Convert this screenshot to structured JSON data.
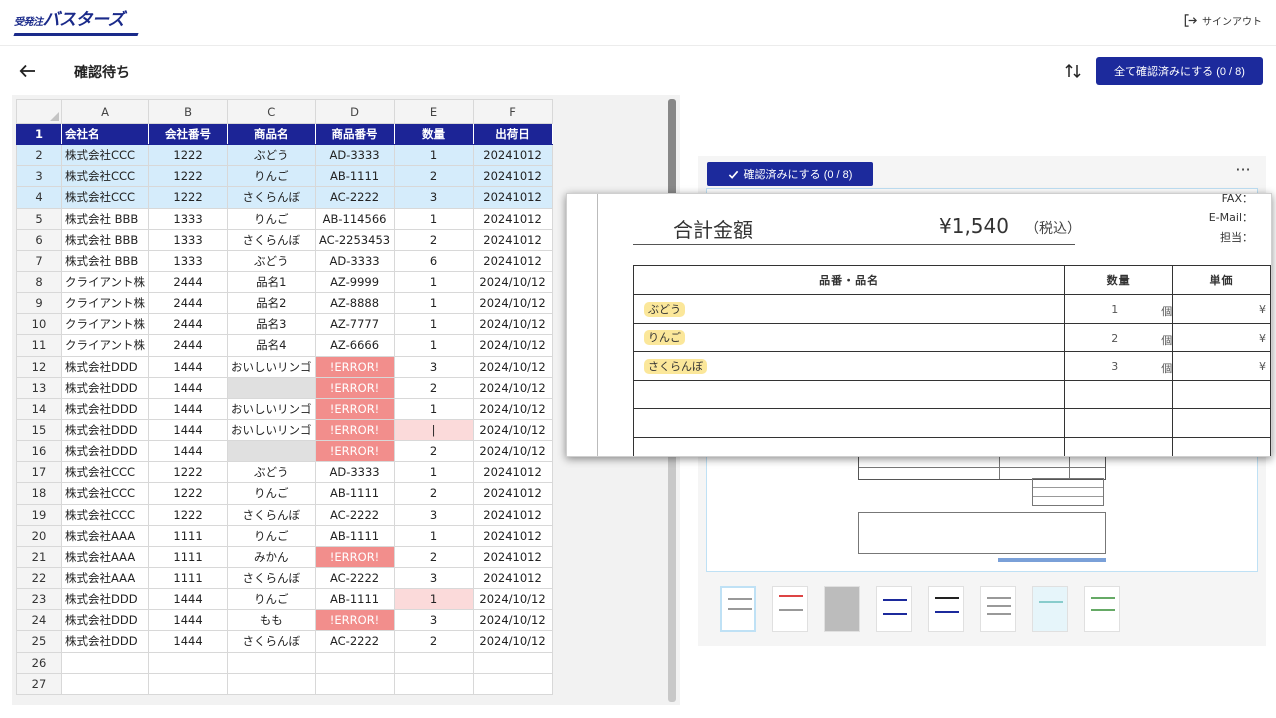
{
  "app": {
    "logo": {
      "prefix": "受発注",
      "main": "バスターズ"
    },
    "signout_label": "サインアウト"
  },
  "page": {
    "title": "確認待ち",
    "confirm_all_label": "全て確認済みにする (0 / 8)"
  },
  "sheet": {
    "columns": [
      "A",
      "B",
      "C",
      "D",
      "E",
      "F"
    ],
    "rows": [
      {
        "n": "1",
        "cells": [
          "会社名",
          "会社番号",
          "商品名",
          "商品番号",
          "数量",
          "出荷日"
        ],
        "style": "header"
      },
      {
        "n": "2",
        "cells": [
          "株式会社CCC",
          "1222",
          "ぶどう",
          "AD-3333",
          "1",
          "20241012"
        ],
        "style": "selected"
      },
      {
        "n": "3",
        "cells": [
          "株式会社CCC",
          "1222",
          "りんご",
          "AB-1111",
          "2",
          "20241012"
        ],
        "style": "selected"
      },
      {
        "n": "4",
        "cells": [
          "株式会社CCC",
          "1222",
          "さくらんぼ",
          "AC-2222",
          "3",
          "20241012"
        ],
        "style": "selected"
      },
      {
        "n": "5",
        "cells": [
          "株式会社 BBB",
          "1333",
          "りんご",
          "AB-114566",
          "1",
          "20241012"
        ]
      },
      {
        "n": "6",
        "cells": [
          "株式会社 BBB",
          "1333",
          "さくらんぼ",
          "AC-2253453",
          "2",
          "20241012"
        ]
      },
      {
        "n": "7",
        "cells": [
          "株式会社 BBB",
          "1333",
          "ぶどう",
          "AD-3333",
          "6",
          "20241012"
        ]
      },
      {
        "n": "8",
        "cells": [
          "クライアント株",
          "2444",
          "品名1",
          "AZ-9999",
          "1",
          "2024/10/12"
        ]
      },
      {
        "n": "9",
        "cells": [
          "クライアント株",
          "2444",
          "品名2",
          "AZ-8888",
          "1",
          "2024/10/12"
        ]
      },
      {
        "n": "10",
        "cells": [
          "クライアント株",
          "2444",
          "品名3",
          "AZ-7777",
          "1",
          "2024/10/12"
        ]
      },
      {
        "n": "11",
        "cells": [
          "クライアント株",
          "2444",
          "品名4",
          "AZ-6666",
          "1",
          "2024/10/12"
        ]
      },
      {
        "n": "12",
        "cells": [
          "株式会社DDD",
          "1444",
          "おいしいリンゴ",
          "!ERROR!",
          "3",
          "2024/10/12"
        ],
        "marks": {
          "3": "err"
        }
      },
      {
        "n": "13",
        "cells": [
          "株式会社DDD",
          "1444",
          "",
          "!ERROR!",
          "2",
          "2024/10/12"
        ],
        "marks": {
          "2": "grey",
          "3": "err"
        }
      },
      {
        "n": "14",
        "cells": [
          "株式会社DDD",
          "1444",
          "おいしいリンゴ",
          "!ERROR!",
          "1",
          "2024/10/12"
        ],
        "marks": {
          "3": "err"
        }
      },
      {
        "n": "15",
        "cells": [
          "株式会社DDD",
          "1444",
          "おいしいリンゴ",
          "!ERROR!",
          "|",
          "2024/10/12"
        ],
        "marks": {
          "3": "err",
          "4": "warn"
        }
      },
      {
        "n": "16",
        "cells": [
          "株式会社DDD",
          "1444",
          "",
          "!ERROR!",
          "2",
          "2024/10/12"
        ],
        "marks": {
          "2": "grey",
          "3": "err"
        }
      },
      {
        "n": "17",
        "cells": [
          "株式会社CCC",
          "1222",
          "ぶどう",
          "AD-3333",
          "1",
          "20241012"
        ]
      },
      {
        "n": "18",
        "cells": [
          "株式会社CCC",
          "1222",
          "りんご",
          "AB-1111",
          "2",
          "20241012"
        ]
      },
      {
        "n": "19",
        "cells": [
          "株式会社CCC",
          "1222",
          "さくらんぼ",
          "AC-2222",
          "3",
          "20241012"
        ]
      },
      {
        "n": "20",
        "cells": [
          "株式会社AAA",
          "1111",
          "りんご",
          "AB-1111",
          "1",
          "20241012"
        ]
      },
      {
        "n": "21",
        "cells": [
          "株式会社AAA",
          "1111",
          "みかん",
          "!ERROR!",
          "2",
          "20241012"
        ],
        "marks": {
          "3": "err"
        }
      },
      {
        "n": "22",
        "cells": [
          "株式会社AAA",
          "1111",
          "さくらんぼ",
          "AC-2222",
          "3",
          "20241012"
        ]
      },
      {
        "n": "23",
        "cells": [
          "株式会社DDD",
          "1444",
          "りんご",
          "AB-1111",
          "1",
          "2024/10/12"
        ],
        "marks": {
          "4": "warn"
        }
      },
      {
        "n": "24",
        "cells": [
          "株式会社DDD",
          "1444",
          "もも",
          "!ERROR!",
          "3",
          "2024/10/12"
        ],
        "marks": {
          "3": "err"
        }
      },
      {
        "n": "25",
        "cells": [
          "株式会社DDD",
          "1444",
          "さくらんぼ",
          "AC-2222",
          "2",
          "2024/10/12"
        ]
      },
      {
        "n": "26",
        "cells": [
          "",
          "",
          "",
          "",
          "",
          ""
        ]
      },
      {
        "n": "27",
        "cells": [
          "",
          "",
          "",
          "",
          "",
          ""
        ]
      }
    ]
  },
  "document": {
    "confirm_label": "確認済みにする (0 / 8)",
    "total_label": "合計金額",
    "total_amount": "¥1,540",
    "tax_label": "（税込）",
    "meta": {
      "fax": "FAX：",
      "email": "E-Mail：",
      "contact": "担当："
    },
    "table_headers": [
      "品番・品名",
      "数量",
      "単価"
    ],
    "items": [
      {
        "name": "ぶどう",
        "qty": "1",
        "unit": "個",
        "price": "¥"
      },
      {
        "name": "りんご",
        "qty": "2",
        "unit": "個",
        "price": "¥"
      },
      {
        "name": "さくらんぼ",
        "qty": "3",
        "unit": "個",
        "price": "¥"
      }
    ],
    "thumbnail_count": 8
  },
  "colors": {
    "primary": "#1c2a9c",
    "header_row": "#1c2496",
    "selected_row": "#d5ecfb",
    "error_cell": "#f28e8c",
    "warn_cell": "#fbdada",
    "highlight": "#fbe79a"
  }
}
